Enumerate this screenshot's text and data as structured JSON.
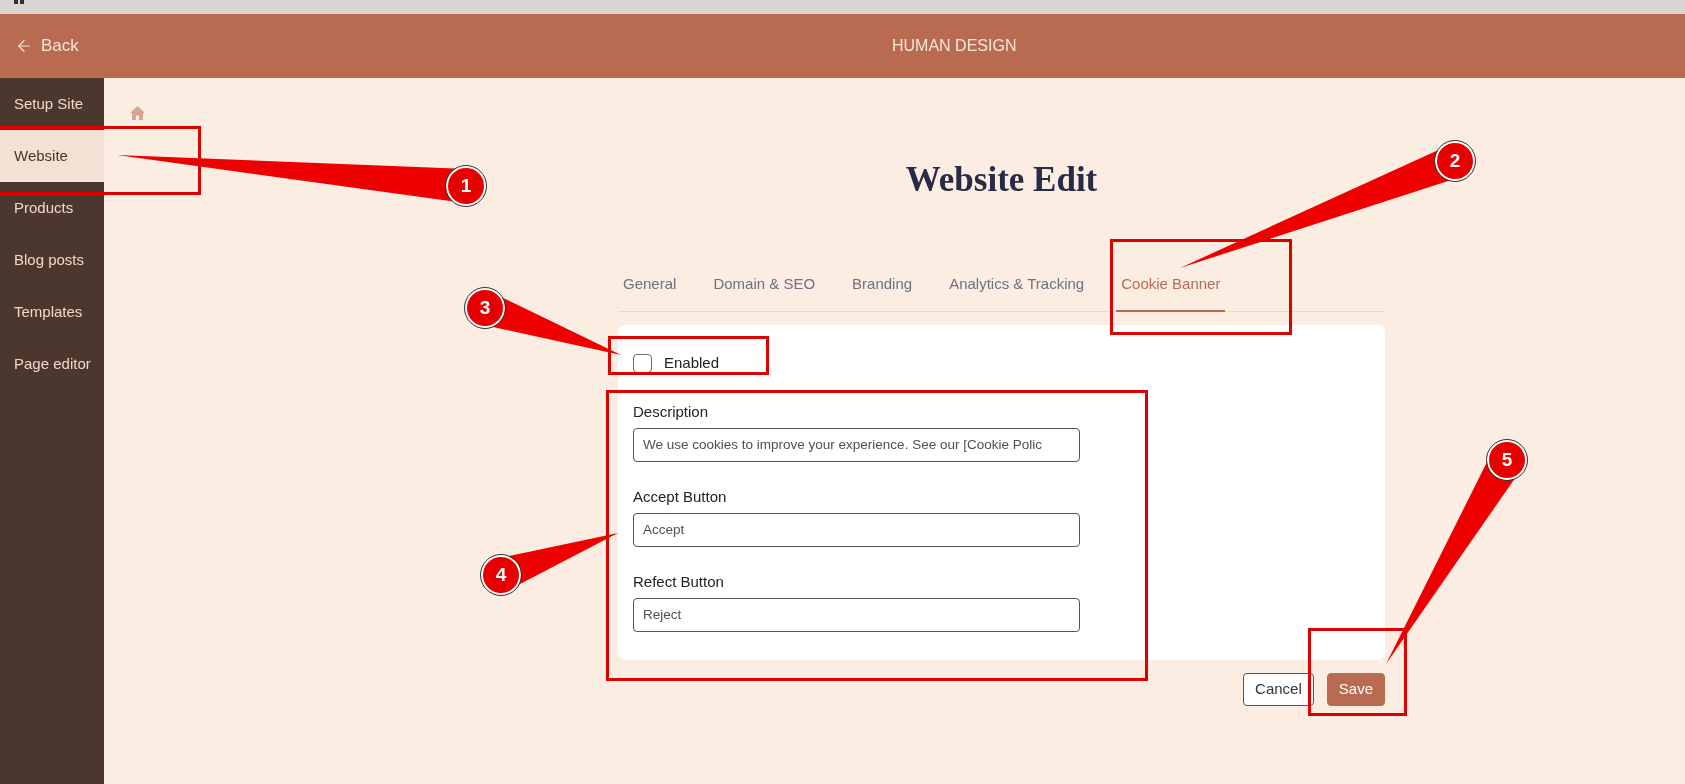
{
  "header": {
    "back": "Back",
    "title": "HUMAN DESIGN"
  },
  "sidebar": {
    "items": [
      {
        "label": "Setup Site",
        "selected": false
      },
      {
        "label": "Website",
        "selected": true
      },
      {
        "label": "Products",
        "selected": false
      },
      {
        "label": "Blog posts",
        "selected": false
      },
      {
        "label": "Templates",
        "selected": false
      },
      {
        "label": "Page editor",
        "selected": false
      }
    ]
  },
  "page": {
    "title": "Website Edit"
  },
  "tabs": [
    {
      "label": "General",
      "selected": false
    },
    {
      "label": "Domain & SEO",
      "selected": false
    },
    {
      "label": "Branding",
      "selected": false
    },
    {
      "label": "Analytics & Tracking",
      "selected": false
    },
    {
      "label": "Cookie Banner",
      "selected": true
    }
  ],
  "cookie_banner": {
    "enabled": {
      "label": "Enabled",
      "checked": false
    },
    "fields": [
      {
        "label": "Description",
        "value": "We use cookies to improve your experience. See our [Cookie Polic"
      },
      {
        "label": "Accept Button",
        "value": "Accept"
      },
      {
        "label": "Refect Button",
        "value": "Reject"
      }
    ]
  },
  "actions": [
    {
      "label": "Cancel",
      "kind": "secondary"
    },
    {
      "label": "Save",
      "kind": "primary"
    }
  ],
  "annotations": [
    {
      "number": "1"
    },
    {
      "number": "2"
    },
    {
      "number": "3"
    },
    {
      "number": "4"
    },
    {
      "number": "5"
    }
  ]
}
